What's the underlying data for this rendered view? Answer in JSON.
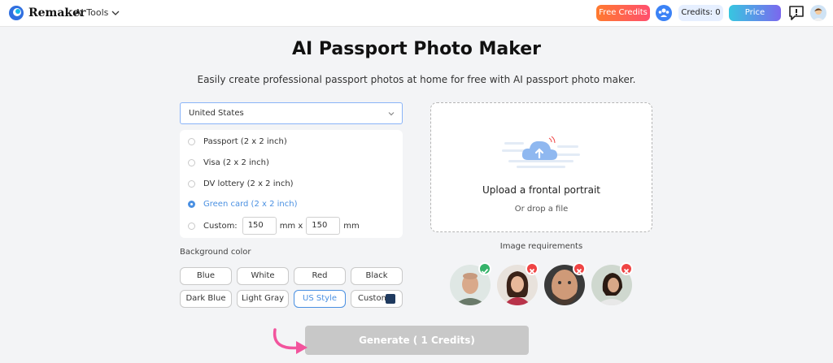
{
  "header": {
    "brand": "Remaker",
    "ai_tools": "AI Tools",
    "free_credits": "Free Credits",
    "credits": "Credits: 0",
    "price": "Price"
  },
  "main": {
    "title": "AI Passport Photo Maker",
    "subtitle": "Easily create professional passport photos at home for free with AI passport photo maker."
  },
  "country": {
    "selected": "United States"
  },
  "documents": [
    {
      "label": "Passport (2 x 2 inch)",
      "selected": false
    },
    {
      "label": "Visa (2 x 2 inch)",
      "selected": false
    },
    {
      "label": "DV lottery (2 x 2 inch)",
      "selected": false
    },
    {
      "label": "Green card (2 x 2 inch)",
      "selected": true
    }
  ],
  "custom": {
    "label": "Custom:",
    "width": "150",
    "height": "150",
    "unit_x": "mm x",
    "unit": "mm"
  },
  "background": {
    "label": "Background color",
    "options": [
      "Blue",
      "White",
      "Red",
      "Black",
      "Dark Blue",
      "Light Gray",
      "US Style",
      "Custom"
    ],
    "selected": "US Style",
    "custom_swatch": "#1f3a5f"
  },
  "upload": {
    "title": "Upload a frontal portrait",
    "subtitle": "Or drop a file"
  },
  "requirements": {
    "label": "Image requirements",
    "examples": [
      "ok",
      "bad",
      "bad",
      "bad"
    ]
  },
  "generate_label": "Generate ( 1 Credits)",
  "colors": {
    "accent": "#4a90e2",
    "ok": "#35b36a",
    "bad": "#ef4444",
    "generate_disabled": "#c8c8c8"
  }
}
